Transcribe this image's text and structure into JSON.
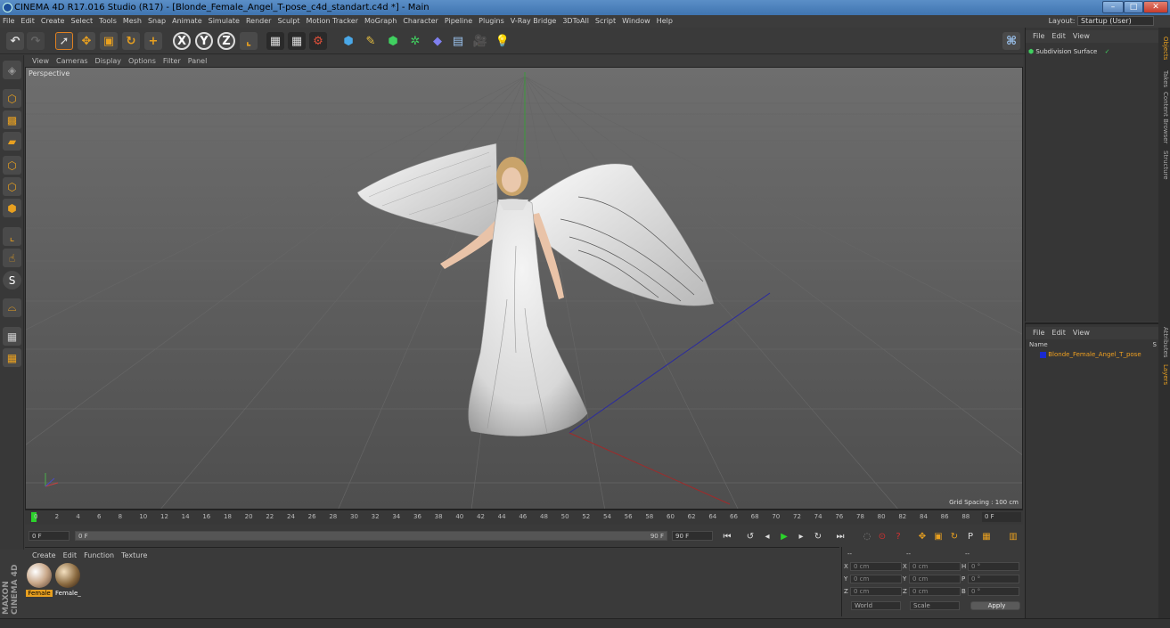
{
  "window": {
    "title": "CINEMA 4D R17.016 Studio (R17) - [Blonde_Female_Angel_T-pose_c4d_standart.c4d *] - Main",
    "minimize": "–",
    "maximize": "□",
    "close": "✕"
  },
  "menubar": {
    "items": [
      "File",
      "Edit",
      "Create",
      "Select",
      "Tools",
      "Mesh",
      "Snap",
      "Animate",
      "Simulate",
      "Render",
      "Sculpt",
      "Motion Tracker",
      "MoGraph",
      "Character",
      "Pipeline",
      "Plugins",
      "V-Ray Bridge",
      "3DToAll",
      "Script",
      "Window",
      "Help"
    ],
    "layout_label": "Layout:",
    "layout_value": "Startup (User)"
  },
  "viewport": {
    "menu": [
      "View",
      "Cameras",
      "Display",
      "Options",
      "Filter",
      "Panel"
    ],
    "label": "Perspective",
    "grid_spacing": "Grid Spacing : 100 cm"
  },
  "timeline": {
    "ticks": [
      "0",
      "2",
      "4",
      "6",
      "8",
      "10",
      "12",
      "14",
      "16",
      "18",
      "20",
      "22",
      "24",
      "26",
      "28",
      "30",
      "32",
      "34",
      "36",
      "38",
      "40",
      "42",
      "44",
      "46",
      "48",
      "50",
      "52",
      "54",
      "56",
      "58",
      "60",
      "62",
      "64",
      "66",
      "68",
      "70",
      "72",
      "74",
      "76",
      "78",
      "80",
      "82",
      "84",
      "86",
      "88",
      "90"
    ],
    "current_frame_display": "0 F"
  },
  "playbar": {
    "start_frame": "0 F",
    "slider_start": "0 F",
    "slider_end": "90 F",
    "end_frame": "90 F"
  },
  "material_manager": {
    "menu": [
      "Create",
      "Edit",
      "Function",
      "Texture"
    ],
    "materials": [
      {
        "name": "Female",
        "selected": true
      },
      {
        "name": "Female_",
        "selected": false
      }
    ],
    "brand_line1": "MAXON",
    "brand_line2": "CINEMA 4D"
  },
  "coordinates": {
    "header1": "--",
    "header2": "--",
    "header3": "--",
    "rows": [
      {
        "a_label": "X",
        "a_value": "0 cm",
        "b_label": "X",
        "b_value": "0 cm",
        "c_label": "H",
        "c_value": "0 °"
      },
      {
        "a_label": "Y",
        "a_value": "0 cm",
        "b_label": "Y",
        "b_value": "0 cm",
        "c_label": "P",
        "c_value": "0 °"
      },
      {
        "a_label": "Z",
        "a_value": "0 cm",
        "b_label": "Z",
        "b_value": "0 cm",
        "c_label": "B",
        "c_value": "0 °"
      }
    ],
    "space": "World",
    "mode": "Scale",
    "apply": "Apply"
  },
  "object_manager": {
    "menu": [
      "File",
      "Edit",
      "View"
    ],
    "object": "Subdivision Surface"
  },
  "layer_manager": {
    "menu": [
      "File",
      "Edit",
      "View"
    ],
    "column_name": "Name",
    "column_s": "S",
    "layer": "Blonde_Female_Angel_T_pose"
  },
  "right_tabs": [
    "Objects",
    "Takes",
    "Content Browser",
    "Structure",
    "Attributes",
    "Layers"
  ],
  "colors": {
    "accent_orange": "#e8a020",
    "selection_blue": "#3a7ccf",
    "play_green": "#2bd32b",
    "record_red": "#d33030",
    "layer_text": "#f0a020"
  }
}
